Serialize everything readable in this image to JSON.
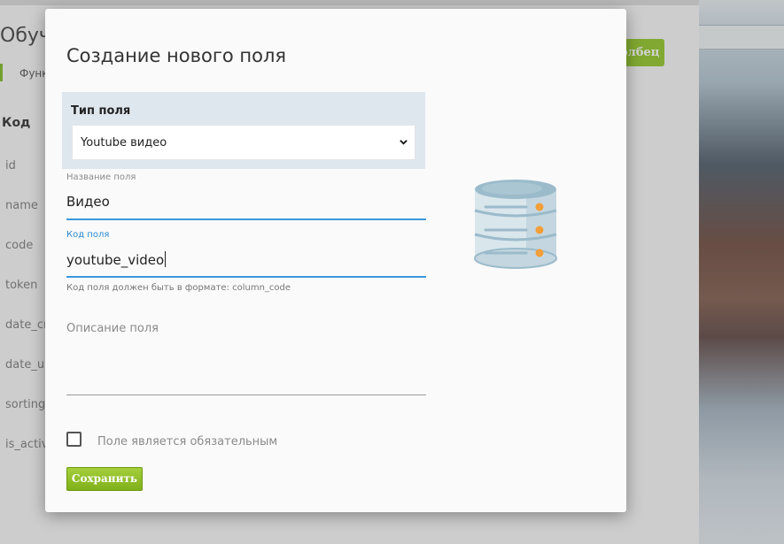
{
  "background": {
    "page_title": "Обуч",
    "tab_label": "Функ",
    "column_header": "Код",
    "rows": [
      "id",
      "name",
      "code",
      "token",
      "date_cr",
      "date_up",
      "sorting_",
      "is_active"
    ],
    "button_label": "олбец"
  },
  "modal": {
    "title": "Создание нового поля",
    "field_type": {
      "label": "Тип поля",
      "selected": "Youtube видео"
    },
    "field_name": {
      "label": "Название поля",
      "value": "Видео"
    },
    "field_code": {
      "label": "Код поля",
      "value": "youtube_video",
      "hint": "Код поля должен быть в формате: column_code"
    },
    "field_description": {
      "placeholder": "Описание поля"
    },
    "required_checkbox": {
      "label": "Поле является обязательным",
      "checked": false
    },
    "save_button": "Сохранить",
    "icon": "database-icon"
  },
  "colors": {
    "accent": "#3b97db",
    "save_button": "#8cbf26",
    "icon_blue": "#9bbbcb",
    "icon_orange": "#f29f3a"
  }
}
